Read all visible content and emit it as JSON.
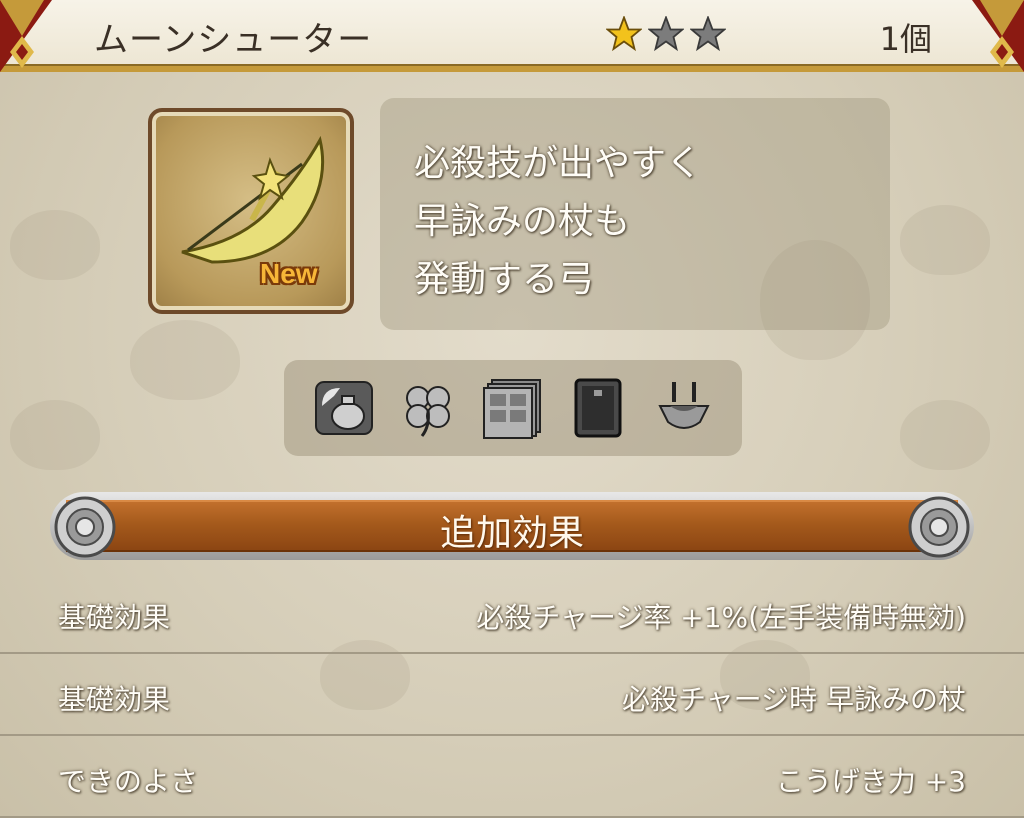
{
  "header": {
    "title": "ムーンシューター",
    "stars": [
      {
        "filled": true
      },
      {
        "filled": false
      },
      {
        "filled": false
      }
    ],
    "count": "1個"
  },
  "item": {
    "icon": "crescent-bow-icon",
    "badge": "New"
  },
  "description": {
    "lines": [
      "必殺技が出やすく",
      "早詠みの杖も",
      "発動する弓"
    ]
  },
  "skill_icons": [
    "bag-icon",
    "clover-icon",
    "cabinet-icon",
    "card-icon",
    "trap-icon"
  ],
  "section": {
    "title": "追加効果"
  },
  "effects": [
    {
      "label": "基礎効果",
      "value": "必殺チャージ率 +1%(左手装備時無効)"
    },
    {
      "label": "基礎効果",
      "value": "必殺チャージ時 早詠みの杖"
    },
    {
      "label": "できのよさ",
      "value": "こうげき力 +3"
    }
  ],
  "colors": {
    "banner": "#a55a1c",
    "header_border": "#c59a3a",
    "star_gold": "#f2c21c",
    "star_gray": "#7c7c7c"
  }
}
